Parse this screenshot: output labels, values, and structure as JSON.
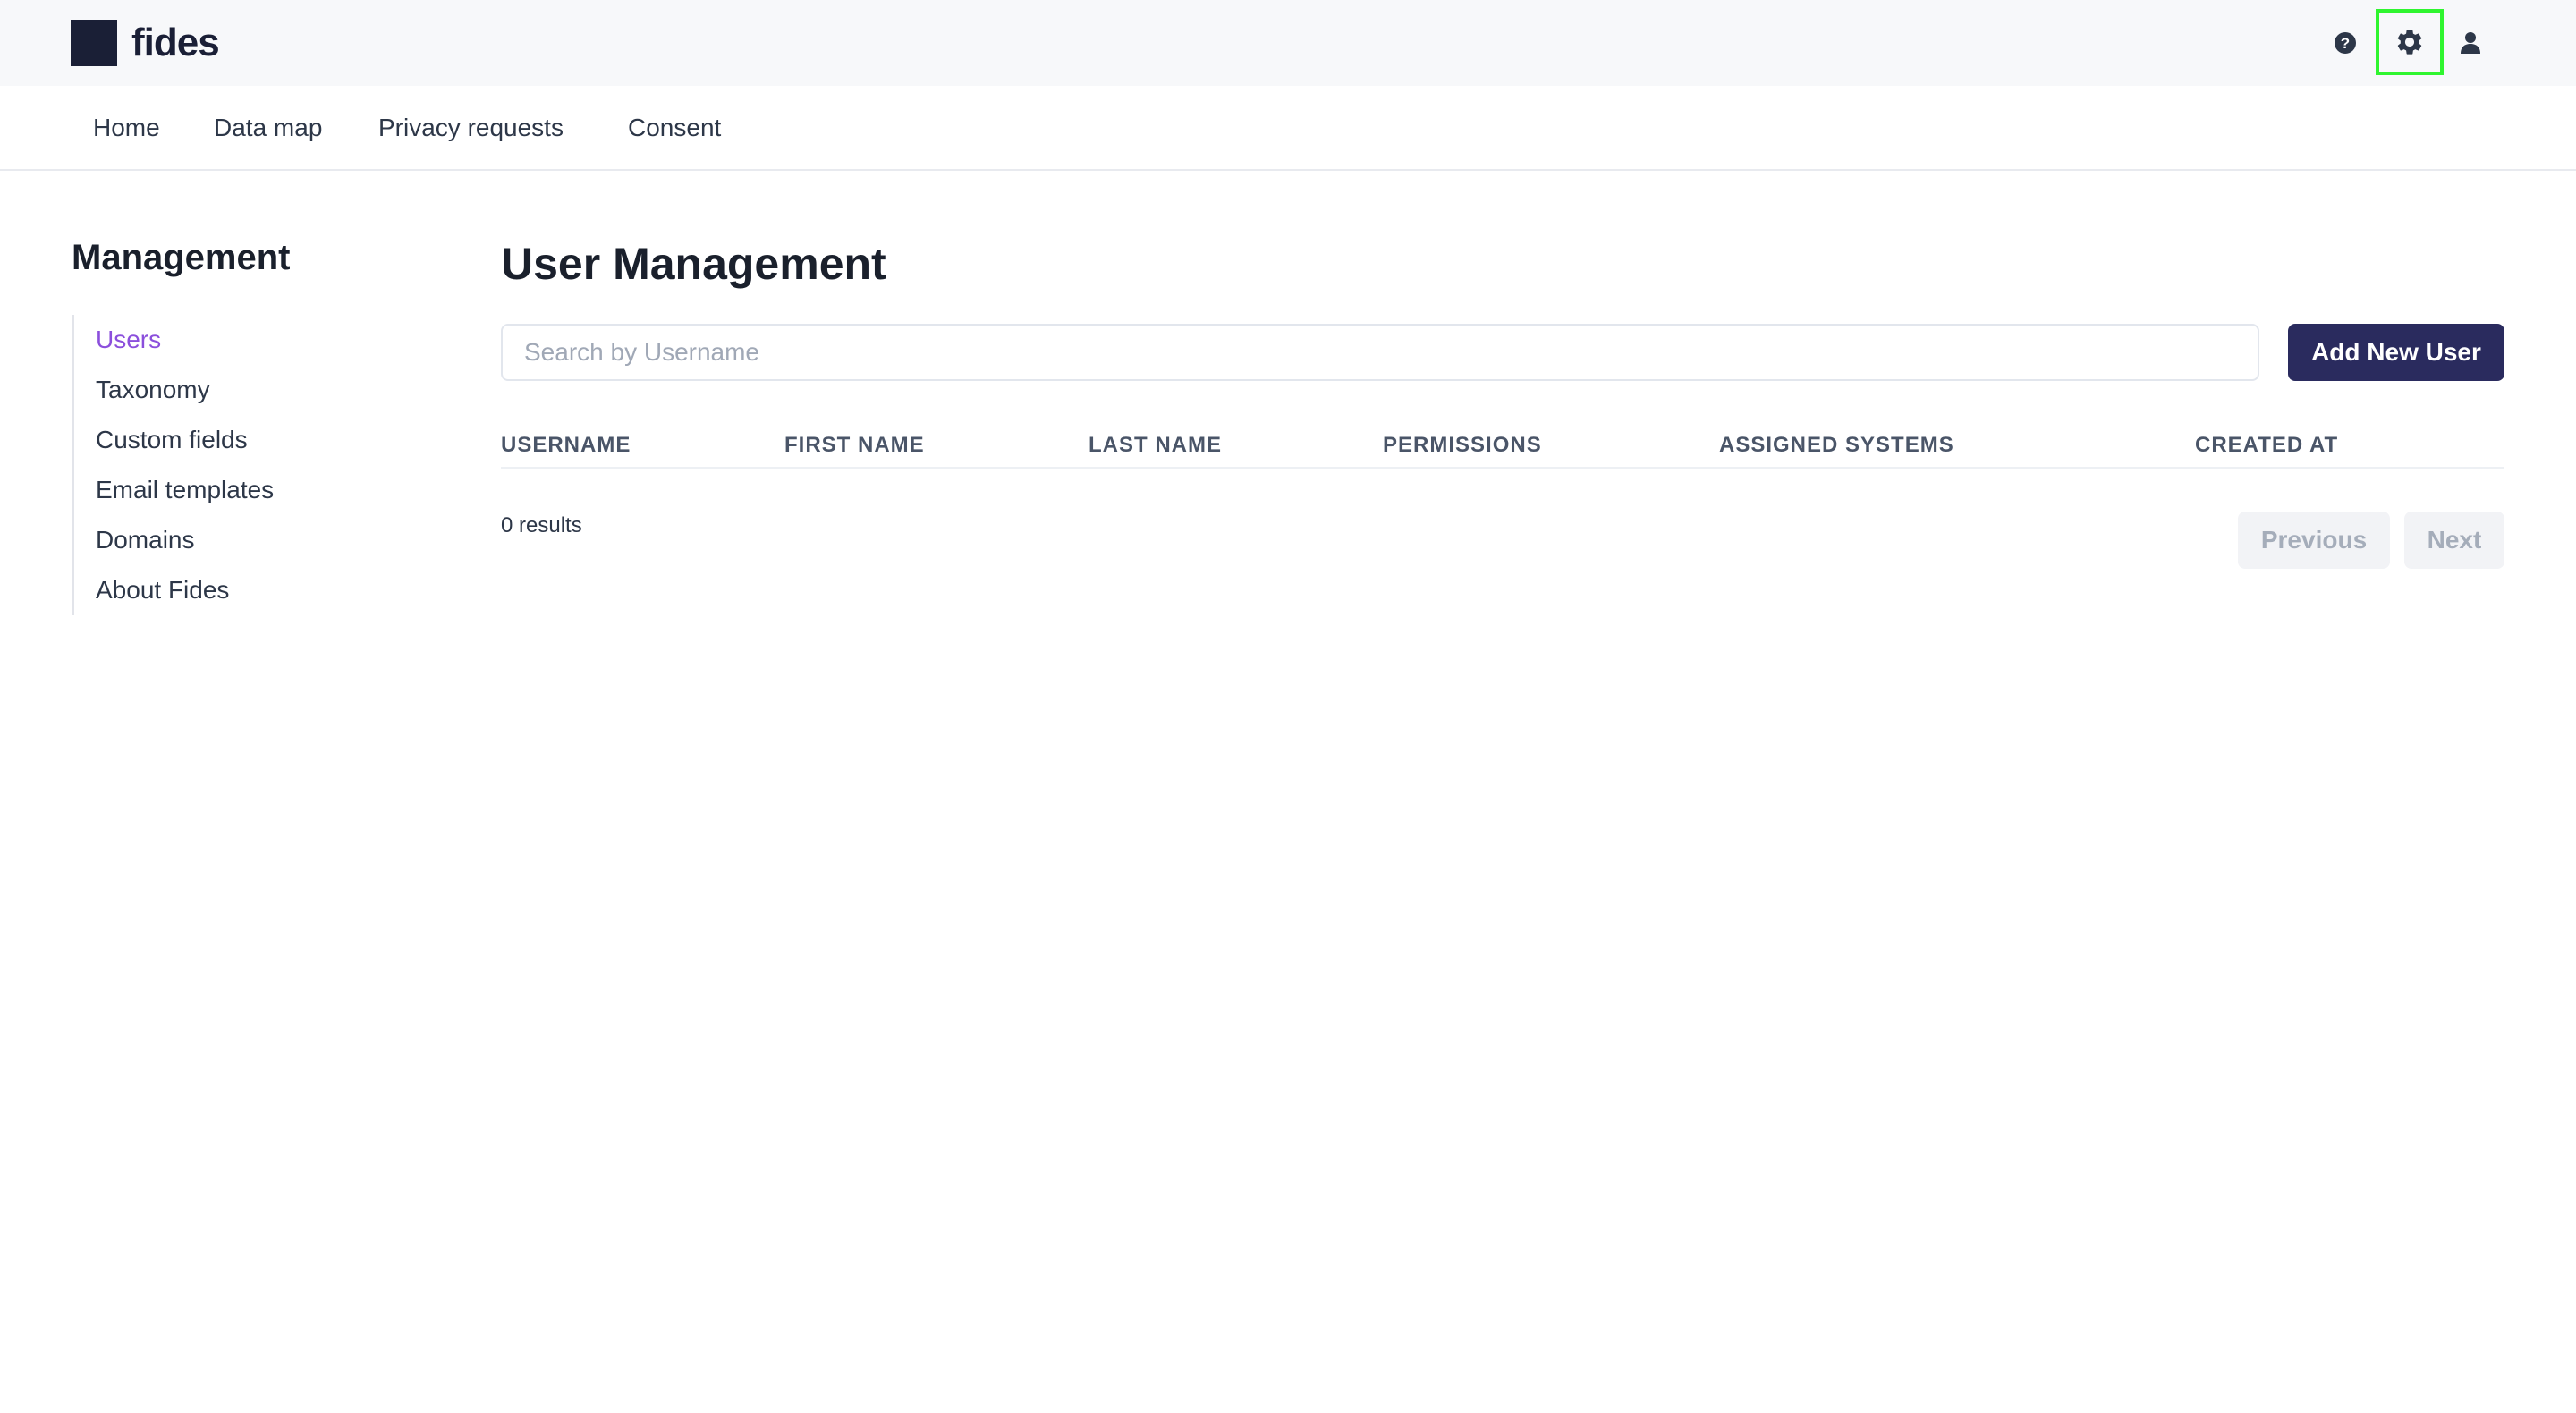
{
  "app": {
    "logo_text": "fides"
  },
  "header": {
    "icons": [
      "help-icon",
      "gear-icon",
      "user-icon"
    ]
  },
  "nav": {
    "items": [
      {
        "label": "Home"
      },
      {
        "label": "Data map"
      },
      {
        "label": "Privacy requests"
      },
      {
        "label": "Consent"
      }
    ]
  },
  "sidebar": {
    "title": "Management",
    "active": "Users",
    "items": [
      {
        "label": "Users"
      },
      {
        "label": "Taxonomy"
      },
      {
        "label": "Custom fields"
      },
      {
        "label": "Email templates"
      },
      {
        "label": "Domains"
      },
      {
        "label": "About Fides"
      }
    ]
  },
  "main": {
    "title": "User Management",
    "search": {
      "placeholder": "Search by Username",
      "value": ""
    },
    "add_button": "Add New User",
    "table": {
      "columns": [
        "USERNAME",
        "FIRST NAME",
        "LAST NAME",
        "PERMISSIONS",
        "ASSIGNED SYSTEMS",
        "CREATED AT"
      ],
      "rows": []
    },
    "results_text": "0 results",
    "pagination": {
      "previous": "Previous",
      "next": "Next"
    }
  },
  "colors": {
    "accent": "#8b4fdc",
    "primary_button": "#2a2b5e",
    "highlight": "#2ff52f"
  }
}
